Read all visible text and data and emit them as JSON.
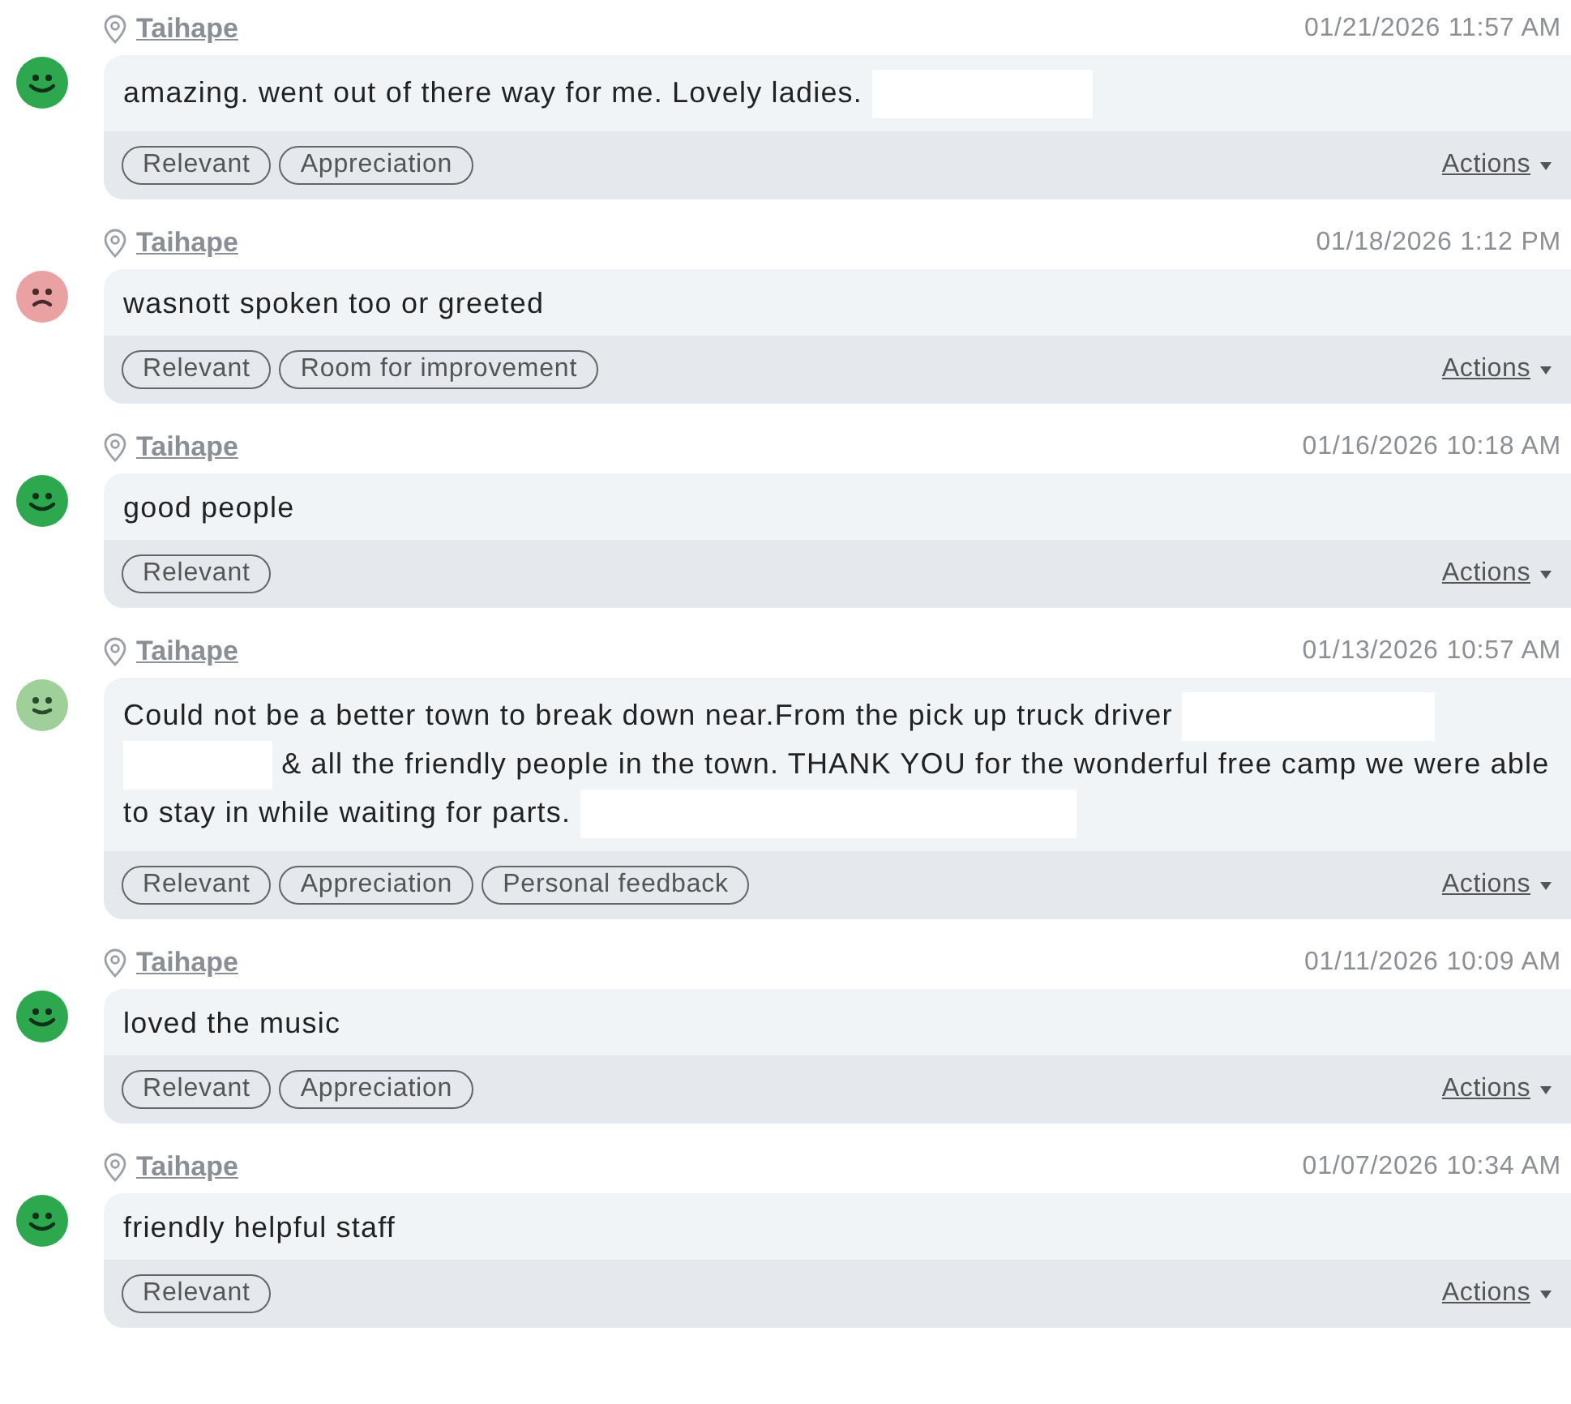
{
  "reviews": [
    {
      "kind": "happy",
      "location": "Taihape",
      "date": "01/21/2026 11:57 AM",
      "comment": [
        {
          "kind": "text",
          "text": "amazing. went out of there way for me. Lovely ladies. "
        },
        {
          "kind": "medium"
        }
      ],
      "tags": [
        "Relevant",
        "Appreciation"
      ],
      "actions": "Actions"
    },
    {
      "kind": "sad",
      "location": "Taihape",
      "date": "01/18/2026 1:12 PM",
      "comment": [
        {
          "kind": "text",
          "text": "wasnott spoken too or greeted"
        }
      ],
      "tags": [
        "Relevant",
        "Room for improvement"
      ],
      "actions": "Actions"
    },
    {
      "kind": "happy",
      "location": "Taihape",
      "date": "01/16/2026 10:18 AM",
      "comment": [
        {
          "kind": "text",
          "text": "good people"
        }
      ],
      "tags": [
        "Relevant"
      ],
      "actions": "Actions"
    },
    {
      "kind": "content",
      "location": "Taihape",
      "date": "01/13/2026 10:57 AM",
      "comment": [
        {
          "kind": "text",
          "text": "Could not be a better town to break down near.From the pick up truck driver "
        },
        {
          "kind": "large"
        },
        {
          "kind": "short"
        },
        {
          "kind": "text",
          "text": " & all the friendly people in the town. THANK YOU for the wonderful free camp we were able to stay in while waiting for parts. "
        },
        {
          "kind": "wide"
        }
      ],
      "tags": [
        "Relevant",
        "Appreciation",
        "Personal feedback"
      ],
      "actions": "Actions"
    },
    {
      "kind": "happy",
      "location": "Taihape",
      "date": "01/11/2026 10:09 AM",
      "comment": [
        {
          "kind": "text",
          "text": "loved the music"
        }
      ],
      "tags": [
        "Relevant",
        "Appreciation"
      ],
      "actions": "Actions"
    },
    {
      "kind": "happy",
      "location": "Taihape",
      "date": "01/07/2026 10:34 AM",
      "comment": [
        {
          "kind": "text",
          "text": "friendly helpful staff"
        }
      ],
      "tags": [
        "Relevant"
      ],
      "actions": "Actions"
    }
  ]
}
